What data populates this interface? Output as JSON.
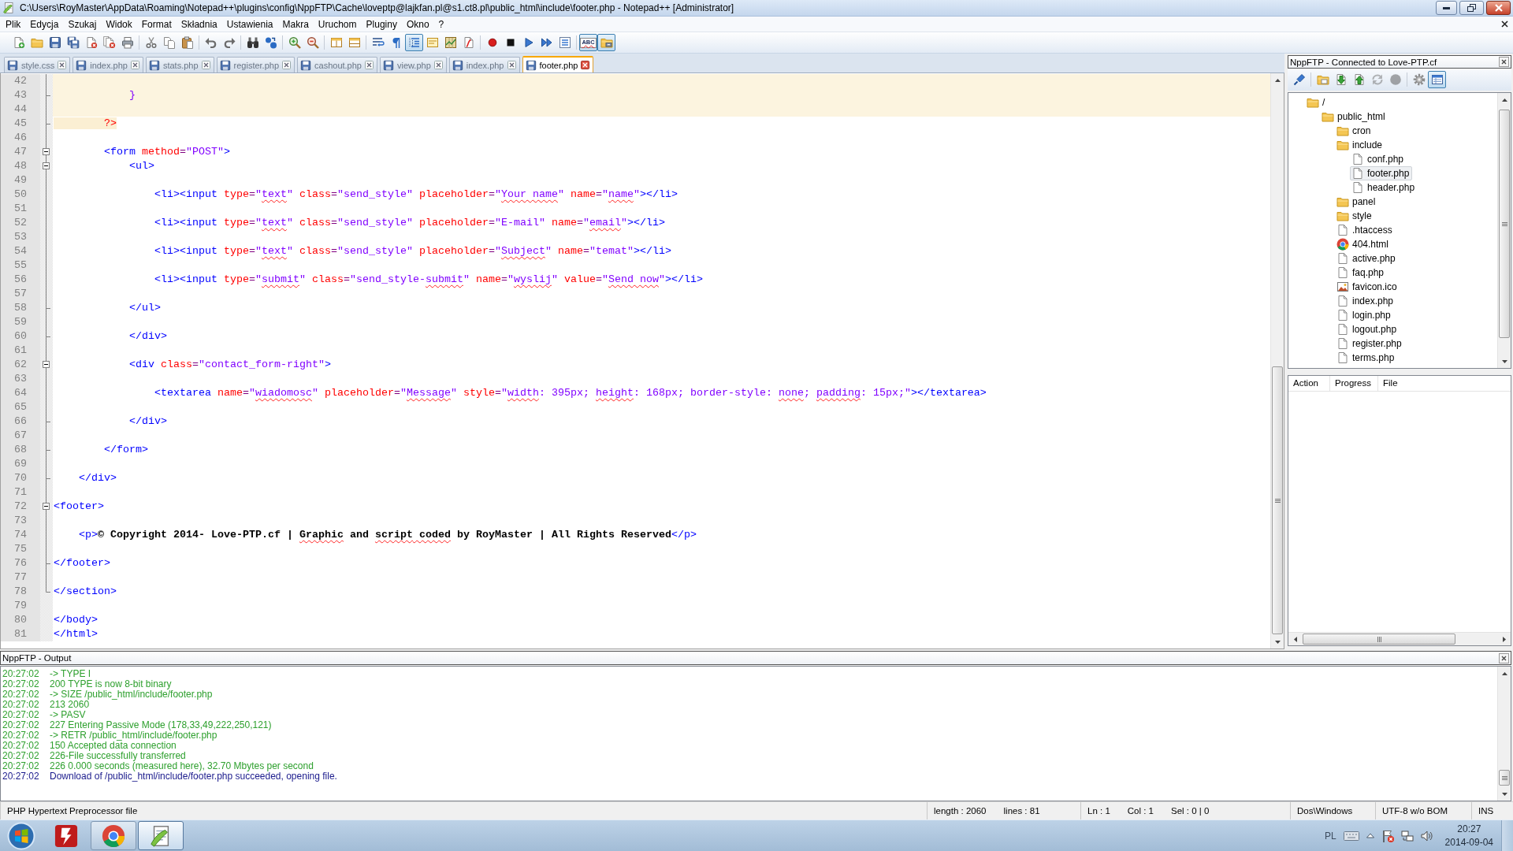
{
  "window": {
    "title": "C:\\Users\\RoyMaster\\AppData\\Roaming\\Notepad++\\plugins\\config\\NppFTP\\Cache\\loveptp@lajkfan.pl@s1.ct8.pl\\public_html\\include\\footer.php - Notepad++ [Administrator]"
  },
  "menu": [
    "Plik",
    "Edycja",
    "Szukaj",
    "Widok",
    "Format",
    "Składnia",
    "Ustawienia",
    "Makra",
    "Uruchom",
    "Pluginy",
    "Okno",
    "?"
  ],
  "toolbar": {
    "groups": [
      {
        "buttons": [
          {
            "pressed": false
          },
          {
            "pressed": false
          },
          {
            "pressed": false
          },
          {
            "pressed": false
          },
          {
            "pressed": false
          },
          {
            "pressed": false
          },
          {
            "pressed": false
          }
        ]
      },
      {
        "buttons": [
          {
            "pressed": false
          },
          {
            "pressed": false
          },
          {
            "pressed": false
          }
        ]
      },
      {
        "buttons": [
          {
            "pressed": false
          },
          {
            "pressed": false
          }
        ]
      },
      {
        "buttons": [
          {
            "pressed": false
          },
          {
            "pressed": false
          }
        ]
      },
      {
        "buttons": [
          {
            "pressed": false
          },
          {
            "pressed": false
          }
        ]
      },
      {
        "buttons": [
          {
            "pressed": false
          },
          {
            "pressed": false
          }
        ]
      },
      {
        "buttons": [
          {
            "pressed": false
          },
          {
            "pressed": false
          },
          {
            "pressed": true
          },
          {
            "pressed": false
          },
          {
            "pressed": false
          },
          {
            "pressed": false
          }
        ]
      },
      {
        "buttons": [
          {
            "pressed": false
          },
          {
            "pressed": false
          },
          {
            "pressed": false
          },
          {
            "pressed": false
          },
          {
            "pressed": false
          }
        ]
      },
      {
        "buttons": [
          {
            "pressed": true,
            "label": "ABC"
          },
          {
            "pressed": true
          }
        ]
      }
    ]
  },
  "tabs": [
    {
      "label": "style.css",
      "selected": false
    },
    {
      "label": "index.php",
      "selected": false
    },
    {
      "label": "stats.php",
      "selected": false
    },
    {
      "label": "register.php",
      "selected": false
    },
    {
      "label": "cashout.php",
      "selected": false
    },
    {
      "label": "view.php",
      "selected": false
    },
    {
      "label": "index.php",
      "selected": false
    },
    {
      "label": "footer.php",
      "selected": true
    }
  ],
  "editor": {
    "lines": [
      {
        "number": "42",
        "kind": "fold_line",
        "php": true
      },
      {
        "number": "43",
        "kind": "fold_end",
        "php": true,
        "tokens": [
          {
            "kind": "php_op",
            "text": "            }",
            "misspelled": false
          }
        ]
      },
      {
        "number": "44",
        "kind": "fold_line",
        "php": true
      },
      {
        "number": "45",
        "kind": "fold_end",
        "php": false,
        "tokens": [
          {
            "kind": "php_tag",
            "text": "        ?>",
            "misspelled": false
          }
        ]
      },
      {
        "number": "46",
        "kind": "fold_line",
        "php": false
      },
      {
        "number": "47",
        "kind": "fold_start",
        "php": false,
        "tokens": [
          {
            "kind": "tag",
            "text": "        <form",
            "misspelled": false
          },
          {
            "kind": "attr",
            "text": " method",
            "misspelled": false
          },
          {
            "kind": "other",
            "text": "=",
            "misspelled": false
          },
          {
            "kind": "value",
            "text": "\"POST\"",
            "misspelled": false
          },
          {
            "kind": "tag",
            "text": ">",
            "misspelled": false
          }
        ]
      },
      {
        "number": "48",
        "kind": "fold_start",
        "php": false,
        "tokens": [
          {
            "kind": "tag",
            "text": "            <ul>",
            "misspelled": false
          }
        ]
      },
      {
        "number": "49",
        "kind": "fold_line",
        "php": false
      },
      {
        "number": "50",
        "kind": "fold_line",
        "php": false,
        "tokens": [
          {
            "kind": "tag",
            "text": "                <li><input",
            "misspelled": false
          },
          {
            "kind": "attr",
            "text": " type",
            "misspelled": false
          },
          {
            "kind": "other",
            "text": "=",
            "misspelled": false
          },
          {
            "kind": "value",
            "text": "\"",
            "misspelled": false
          },
          {
            "kind": "value",
            "text": "text",
            "misspelled": true
          },
          {
            "kind": "value",
            "text": "\"",
            "misspelled": false
          },
          {
            "kind": "attr",
            "text": " class",
            "misspelled": false
          },
          {
            "kind": "other",
            "text": "=",
            "misspelled": false
          },
          {
            "kind": "value",
            "text": "\"send_style\"",
            "misspelled": false
          },
          {
            "kind": "attr",
            "text": " placeholder",
            "misspelled": false
          },
          {
            "kind": "other",
            "text": "=",
            "misspelled": false
          },
          {
            "kind": "value",
            "text": "\"",
            "misspelled": false
          },
          {
            "kind": "value",
            "text": "Your name",
            "misspelled": true
          },
          {
            "kind": "value",
            "text": "\"",
            "misspelled": false
          },
          {
            "kind": "attr",
            "text": " name",
            "misspelled": false
          },
          {
            "kind": "other",
            "text": "=",
            "misspelled": false
          },
          {
            "kind": "value",
            "text": "\"",
            "misspelled": false
          },
          {
            "kind": "value",
            "text": "name",
            "misspelled": true
          },
          {
            "kind": "value",
            "text": "\"",
            "misspelled": false
          },
          {
            "kind": "tag",
            "text": "></li>",
            "misspelled": false
          }
        ]
      },
      {
        "number": "51",
        "kind": "fold_line",
        "php": false
      },
      {
        "number": "52",
        "kind": "fold_line",
        "php": false,
        "tokens": [
          {
            "kind": "tag",
            "text": "                <li><input",
            "misspelled": false
          },
          {
            "kind": "attr",
            "text": " type",
            "misspelled": false
          },
          {
            "kind": "other",
            "text": "=",
            "misspelled": false
          },
          {
            "kind": "value",
            "text": "\"",
            "misspelled": false
          },
          {
            "kind": "value",
            "text": "text",
            "misspelled": true
          },
          {
            "kind": "value",
            "text": "\"",
            "misspelled": false
          },
          {
            "kind": "attr",
            "text": " class",
            "misspelled": false
          },
          {
            "kind": "other",
            "text": "=",
            "misspelled": false
          },
          {
            "kind": "value",
            "text": "\"send_style\"",
            "misspelled": false
          },
          {
            "kind": "attr",
            "text": " placeholder",
            "misspelled": false
          },
          {
            "kind": "other",
            "text": "=",
            "misspelled": false
          },
          {
            "kind": "value",
            "text": "\"E-mail\"",
            "misspelled": false
          },
          {
            "kind": "attr",
            "text": " name",
            "misspelled": false
          },
          {
            "kind": "other",
            "text": "=",
            "misspelled": false
          },
          {
            "kind": "value",
            "text": "\"",
            "misspelled": false
          },
          {
            "kind": "value",
            "text": "email",
            "misspelled": true
          },
          {
            "kind": "value",
            "text": "\"",
            "misspelled": false
          },
          {
            "kind": "tag",
            "text": "></li>",
            "misspelled": false
          }
        ]
      },
      {
        "number": "53",
        "kind": "fold_line",
        "php": false
      },
      {
        "number": "54",
        "kind": "fold_line",
        "php": false,
        "tokens": [
          {
            "kind": "tag",
            "text": "                <li><input",
            "misspelled": false
          },
          {
            "kind": "attr",
            "text": " type",
            "misspelled": false
          },
          {
            "kind": "other",
            "text": "=",
            "misspelled": false
          },
          {
            "kind": "value",
            "text": "\"",
            "misspelled": false
          },
          {
            "kind": "value",
            "text": "text",
            "misspelled": true
          },
          {
            "kind": "value",
            "text": "\"",
            "misspelled": false
          },
          {
            "kind": "attr",
            "text": " class",
            "misspelled": false
          },
          {
            "kind": "other",
            "text": "=",
            "misspelled": false
          },
          {
            "kind": "value",
            "text": "\"send_style\"",
            "misspelled": false
          },
          {
            "kind": "attr",
            "text": " placeholder",
            "misspelled": false
          },
          {
            "kind": "other",
            "text": "=",
            "misspelled": false
          },
          {
            "kind": "value",
            "text": "\"",
            "misspelled": false
          },
          {
            "kind": "value",
            "text": "Subject",
            "misspelled": true
          },
          {
            "kind": "value",
            "text": "\"",
            "misspelled": false
          },
          {
            "kind": "attr",
            "text": " name",
            "misspelled": false
          },
          {
            "kind": "other",
            "text": "=",
            "misspelled": false
          },
          {
            "kind": "value",
            "text": "\"temat\"",
            "misspelled": false
          },
          {
            "kind": "tag",
            "text": "></li>",
            "misspelled": false
          }
        ]
      },
      {
        "number": "55",
        "kind": "fold_line",
        "php": false
      },
      {
        "number": "56",
        "kind": "fold_line",
        "php": false,
        "tokens": [
          {
            "kind": "tag",
            "text": "                <li><input",
            "misspelled": false
          },
          {
            "kind": "attr",
            "text": " type",
            "misspelled": false
          },
          {
            "kind": "other",
            "text": "=",
            "misspelled": false
          },
          {
            "kind": "value",
            "text": "\"",
            "misspelled": false
          },
          {
            "kind": "value",
            "text": "submit",
            "misspelled": true
          },
          {
            "kind": "value",
            "text": "\"",
            "misspelled": false
          },
          {
            "kind": "attr",
            "text": " class",
            "misspelled": false
          },
          {
            "kind": "other",
            "text": "=",
            "misspelled": false
          },
          {
            "kind": "value",
            "text": "\"send_style-",
            "misspelled": false
          },
          {
            "kind": "value",
            "text": "submit",
            "misspelled": true
          },
          {
            "kind": "value",
            "text": "\"",
            "misspelled": false
          },
          {
            "kind": "attr",
            "text": " name",
            "misspelled": false
          },
          {
            "kind": "other",
            "text": "=",
            "misspelled": false
          },
          {
            "kind": "value",
            "text": "\"",
            "misspelled": false
          },
          {
            "kind": "value",
            "text": "wyslij",
            "misspelled": true
          },
          {
            "kind": "value",
            "text": "\"",
            "misspelled": false
          },
          {
            "kind": "attr",
            "text": " value",
            "misspelled": false
          },
          {
            "kind": "other",
            "text": "=",
            "misspelled": false
          },
          {
            "kind": "value",
            "text": "\"",
            "misspelled": false
          },
          {
            "kind": "value",
            "text": "Send now",
            "misspelled": true
          },
          {
            "kind": "value",
            "text": "\"",
            "misspelled": false
          },
          {
            "kind": "tag",
            "text": "></li>",
            "misspelled": false
          }
        ]
      },
      {
        "number": "57",
        "kind": "fold_line",
        "php": false
      },
      {
        "number": "58",
        "kind": "fold_end",
        "php": false,
        "tokens": [
          {
            "kind": "tag",
            "text": "            </ul>",
            "misspelled": false
          }
        ]
      },
      {
        "number": "59",
        "kind": "fold_line",
        "php": false
      },
      {
        "number": "60",
        "kind": "fold_end",
        "php": false,
        "tokens": [
          {
            "kind": "tag",
            "text": "            </div>",
            "misspelled": false
          }
        ]
      },
      {
        "number": "61",
        "kind": "fold_line",
        "php": false
      },
      {
        "number": "62",
        "kind": "fold_start",
        "php": false,
        "tokens": [
          {
            "kind": "tag",
            "text": "            <div",
            "misspelled": false
          },
          {
            "kind": "attr",
            "text": " class",
            "misspelled": false
          },
          {
            "kind": "other",
            "text": "=",
            "misspelled": false
          },
          {
            "kind": "value",
            "text": "\"contact_form-right\"",
            "misspelled": false
          },
          {
            "kind": "tag",
            "text": ">",
            "misspelled": false
          }
        ]
      },
      {
        "number": "63",
        "kind": "fold_line",
        "php": false
      },
      {
        "number": "64",
        "kind": "fold_line",
        "php": false,
        "tokens": [
          {
            "kind": "tag",
            "text": "                <textarea",
            "misspelled": false
          },
          {
            "kind": "attr",
            "text": " name",
            "misspelled": false
          },
          {
            "kind": "other",
            "text": "=",
            "misspelled": false
          },
          {
            "kind": "value",
            "text": "\"",
            "misspelled": false
          },
          {
            "kind": "value",
            "text": "wiadomosc",
            "misspelled": true
          },
          {
            "kind": "value",
            "text": "\"",
            "misspelled": false
          },
          {
            "kind": "attr",
            "text": " placeholder",
            "misspelled": false
          },
          {
            "kind": "other",
            "text": "=",
            "misspelled": false
          },
          {
            "kind": "value",
            "text": "\"",
            "misspelled": false
          },
          {
            "kind": "value",
            "text": "Message",
            "misspelled": true
          },
          {
            "kind": "value",
            "text": "\"",
            "misspelled": false
          },
          {
            "kind": "attr",
            "text": " style",
            "misspelled": false
          },
          {
            "kind": "other",
            "text": "=",
            "misspelled": false
          },
          {
            "kind": "value",
            "text": "\"",
            "misspelled": false
          },
          {
            "kind": "value",
            "text": "width",
            "misspelled": true
          },
          {
            "kind": "value",
            "text": ": 395px; ",
            "misspelled": false
          },
          {
            "kind": "value",
            "text": "height",
            "misspelled": true
          },
          {
            "kind": "value",
            "text": ": 168px; border-style: ",
            "misspelled": false
          },
          {
            "kind": "value",
            "text": "none",
            "misspelled": true
          },
          {
            "kind": "value",
            "text": "; ",
            "misspelled": false
          },
          {
            "kind": "value",
            "text": "padding",
            "misspelled": true
          },
          {
            "kind": "value",
            "text": ": 15px;\"",
            "misspelled": false
          },
          {
            "kind": "tag",
            "text": "></textarea>",
            "misspelled": false
          }
        ]
      },
      {
        "number": "65",
        "kind": "fold_line",
        "php": false
      },
      {
        "number": "66",
        "kind": "fold_end",
        "php": false,
        "tokens": [
          {
            "kind": "tag",
            "text": "            </div>",
            "misspelled": false
          }
        ]
      },
      {
        "number": "67",
        "kind": "fold_line",
        "php": false
      },
      {
        "number": "68",
        "kind": "fold_end",
        "php": false,
        "tokens": [
          {
            "kind": "tag",
            "text": "        </form>",
            "misspelled": false
          }
        ]
      },
      {
        "number": "69",
        "kind": "fold_line",
        "php": false
      },
      {
        "number": "70",
        "kind": "fold_end",
        "php": false,
        "tokens": [
          {
            "kind": "tag",
            "text": "    </div>",
            "misspelled": false
          }
        ]
      },
      {
        "number": "71",
        "kind": "fold_line",
        "php": false
      },
      {
        "number": "72",
        "kind": "fold_start",
        "php": false,
        "tokens": [
          {
            "kind": "tag",
            "text": "<footer>",
            "misspelled": false
          }
        ]
      },
      {
        "number": "73",
        "kind": "fold_line",
        "php": false
      },
      {
        "number": "74",
        "kind": "fold_line",
        "php": false,
        "tokens": [
          {
            "kind": "tag",
            "text": "    <p>",
            "misspelled": false
          },
          {
            "kind": "text",
            "text": "© Copyright 2014- Love-PTP.cf | ",
            "misspelled": false
          },
          {
            "kind": "text",
            "text": "Graphic",
            "misspelled": true
          },
          {
            "kind": "text",
            "text": " and ",
            "misspelled": false
          },
          {
            "kind": "text",
            "text": "script",
            "misspelled": true
          },
          {
            "kind": "text",
            "text": " coded",
            "misspelled": true
          },
          {
            "kind": "text",
            "text": " by RoyMaster | All Rights Reserved",
            "misspelled": false
          },
          {
            "kind": "tag",
            "text": "</p>",
            "misspelled": false
          }
        ]
      },
      {
        "number": "75",
        "kind": "fold_line",
        "php": false
      },
      {
        "number": "76",
        "kind": "fold_end",
        "php": false,
        "tokens": [
          {
            "kind": "tag",
            "text": "</footer>",
            "misspelled": false
          }
        ]
      },
      {
        "number": "77",
        "kind": "fold_line",
        "php": false
      },
      {
        "number": "78",
        "kind": "fold_last",
        "php": false,
        "tokens": [
          {
            "kind": "tag",
            "text": "</section>",
            "misspelled": false
          }
        ]
      },
      {
        "number": "79",
        "kind": "plain",
        "php": false
      },
      {
        "number": "80",
        "kind": "plain",
        "php": false,
        "tokens": [
          {
            "kind": "tag",
            "text": "</body>",
            "misspelled": false
          }
        ]
      },
      {
        "number": "81",
        "kind": "plain",
        "php": false,
        "tokens": [
          {
            "kind": "tag",
            "text": "</html>",
            "misspelled": false
          }
        ]
      }
    ]
  },
  "ftp_panel": {
    "title": "NppFTP - Connected to Love-PTP.cf",
    "toolbar": [
      {
        "disabled": false,
        "pressed": false
      },
      {
        "disabled": false,
        "pressed": false
      },
      {
        "disabled": false,
        "pressed": false
      },
      {
        "disabled": false,
        "pressed": false
      },
      {
        "disabled": true,
        "pressed": false
      },
      {
        "disabled": true,
        "pressed": false
      },
      {
        "disabled": false,
        "pressed": false
      },
      {
        "disabled": false,
        "pressed": true
      }
    ],
    "tree": [
      {
        "label": "/",
        "kind": "folder",
        "selected": false,
        "children": [
          {
            "label": "public_html",
            "kind": "folder",
            "selected": false,
            "children": [
              {
                "label": "cron",
                "kind": "folder",
                "selected": false
              },
              {
                "label": "include",
                "kind": "folder",
                "selected": false,
                "children": [
                  {
                    "label": "conf.php",
                    "kind": "file",
                    "selected": false
                  },
                  {
                    "label": "footer.php",
                    "kind": "file",
                    "selected": true
                  },
                  {
                    "label": "header.php",
                    "kind": "file",
                    "selected": false
                  }
                ]
              },
              {
                "label": "panel",
                "kind": "folder",
                "selected": false
              },
              {
                "label": "style",
                "kind": "folder",
                "selected": false
              },
              {
                "label": ".htaccess",
                "kind": "file",
                "selected": false
              },
              {
                "label": "404.html",
                "kind": "web",
                "selected": false
              },
              {
                "label": "active.php",
                "kind": "file",
                "selected": false
              },
              {
                "label": "faq.php",
                "kind": "file",
                "selected": false
              },
              {
                "label": "favicon.ico",
                "kind": "image",
                "selected": false
              },
              {
                "label": "index.php",
                "kind": "file",
                "selected": false
              },
              {
                "label": "login.php",
                "kind": "file",
                "selected": false
              },
              {
                "label": "logout.php",
                "kind": "file",
                "selected": false
              },
              {
                "label": "register.php",
                "kind": "file",
                "selected": false
              },
              {
                "label": "terms.php",
                "kind": "file",
                "selected": false
              }
            ]
          }
        ]
      }
    ],
    "queue": {
      "columns": [
        "Action",
        "Progress",
        "File"
      ]
    }
  },
  "output": {
    "title": "NppFTP - Output",
    "lines": [
      {
        "time": "20:27:02",
        "message": "-> TYPE I",
        "color": "#2ea02e"
      },
      {
        "time": "20:27:02",
        "message": "200 TYPE is now 8-bit binary",
        "color": "#2ea02e"
      },
      {
        "time": "20:27:02",
        "message": "-> SIZE /public_html/include/footer.php",
        "color": "#2ea02e"
      },
      {
        "time": "20:27:02",
        "message": "213 2060",
        "color": "#2ea02e"
      },
      {
        "time": "20:27:02",
        "message": "-> PASV",
        "color": "#2ea02e"
      },
      {
        "time": "20:27:02",
        "message": "227 Entering Passive Mode (178,33,49,222,250,121)",
        "color": "#2ea02e"
      },
      {
        "time": "20:27:02",
        "message": "-> RETR /public_html/include/footer.php",
        "color": "#2ea02e"
      },
      {
        "time": "20:27:02",
        "message": "150 Accepted data connection",
        "color": "#2ea02e"
      },
      {
        "time": "20:27:02",
        "message": "226-File successfully transferred",
        "color": "#2ea02e"
      },
      {
        "time": "20:27:02",
        "message": "226 0.000 seconds (measured here), 32.70 Mbytes per second",
        "color": "#2ea02e"
      },
      {
        "time": "20:27:02",
        "message": "Download of /public_html/include/footer.php succeeded, opening file.",
        "color": "#1a1a8c"
      }
    ]
  },
  "status_bar": {
    "cells": [
      {
        "texts": [
          "PHP Hypertext Preprocessor file"
        ]
      },
      {
        "texts": [
          "length : 2060",
          "lines : 81"
        ]
      },
      {
        "texts": [
          "Ln : 1",
          "Col : 1",
          "Sel : 0 | 0"
        ]
      },
      {
        "texts": [
          "Dos\\Windows"
        ]
      },
      {
        "texts": [
          "UTF-8 w/o BOM"
        ]
      },
      {
        "texts": [
          "INS"
        ]
      }
    ]
  },
  "taskbar": {
    "apps": [
      {
        "running": false,
        "selected": false
      },
      {
        "running": true,
        "selected": false
      },
      {
        "running": true,
        "selected": true
      }
    ],
    "tray": {
      "language": "PL",
      "time": "20:27",
      "date": "2014-09-04"
    }
  }
}
